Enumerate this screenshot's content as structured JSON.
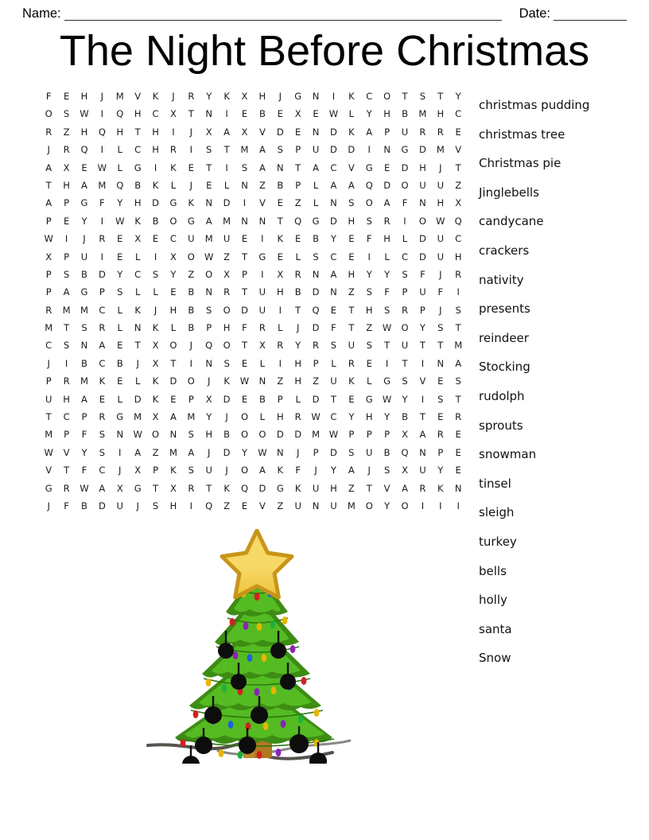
{
  "header": {
    "name_label": "Name:",
    "date_label": "Date:"
  },
  "title": "The Night Before Christmas",
  "grid": {
    "rows": 24,
    "cols": 24,
    "letters": [
      "F E H J M V K J R Y K X H J G N I K C O T S T Y",
      "O S W I Q H C X T N I E B E X E W L Y H B M H C",
      "R Z H Q H T H I J X A X V D E N D K A P U R R E",
      "J R Q I L C H R I S T M A S P U D D I N G D M V",
      "A X E W L G I K E T I S A N T A C V G E D H J T",
      "T H A M Q B K L J E L N Z B P L A A Q D O U U Z",
      "A P G F Y H D G K N D I V E Z L N S O A F N H X",
      "P E Y I W K B O G A M N N T Q G D H S R I O W Q",
      "W I J R E X E C U M U E I K E B Y E F H L D U C",
      "X P U I E L I X O W Z T G E L S C E I L C D U H",
      "P S B D Y C S Y Z O X P I X R N A H Y Y S F J R",
      "P A G P S L L E B N R T U H B D N Z S F P U F I",
      "R M M C L K J H B S O D U I T Q E T H S R P J S",
      "M T S R L N K L B P H F R L J D F T Z W O Y S T",
      "C S N A E T X O J Q O T X R Y R S U S T U T T M",
      "J I B C B J X T I N S E L I H P L R E I T I N A",
      "P R M K E L K D O J K W N Z H Z U K L G S V E S",
      "U H A E L D K E P X D E B P L D T E G W Y I S T",
      "T C P R G M X A M Y J O L H R W C Y H Y B T E R",
      "M P F S N W O N S H B O O D D M W P P P X A R E",
      "W V Y S I A Z M A J D Y W N J P D S U B Q N P E",
      "V T F C J X P K S U J O A K F J Y A J S X U Y E",
      "G R W A X G T X R T K Q D G K U H Z T V A R K N",
      "J F B D U J S H I Q Z E V Z U N U M O Y O I I I"
    ]
  },
  "words": [
    "christmas pudding",
    "christmas tree",
    "Christmas pie",
    "Jinglebells",
    "candycane",
    "crackers",
    "nativity",
    "presents",
    "reindeer",
    "Stocking",
    "rudolph",
    "sprouts",
    "snowman",
    "tinsel",
    "sleigh",
    "turkey",
    "bells",
    "holly",
    "santa",
    "Snow"
  ],
  "illustration": {
    "name": "christmas-tree",
    "colors": {
      "star_fill": "#f5d76e",
      "star_outline": "#c8951a",
      "foliage_light": "#55bb22",
      "foliage_dark": "#3d8c14",
      "trunk": "#b07820",
      "ornament": "#0d0d0d",
      "ground": "#57534e"
    }
  }
}
